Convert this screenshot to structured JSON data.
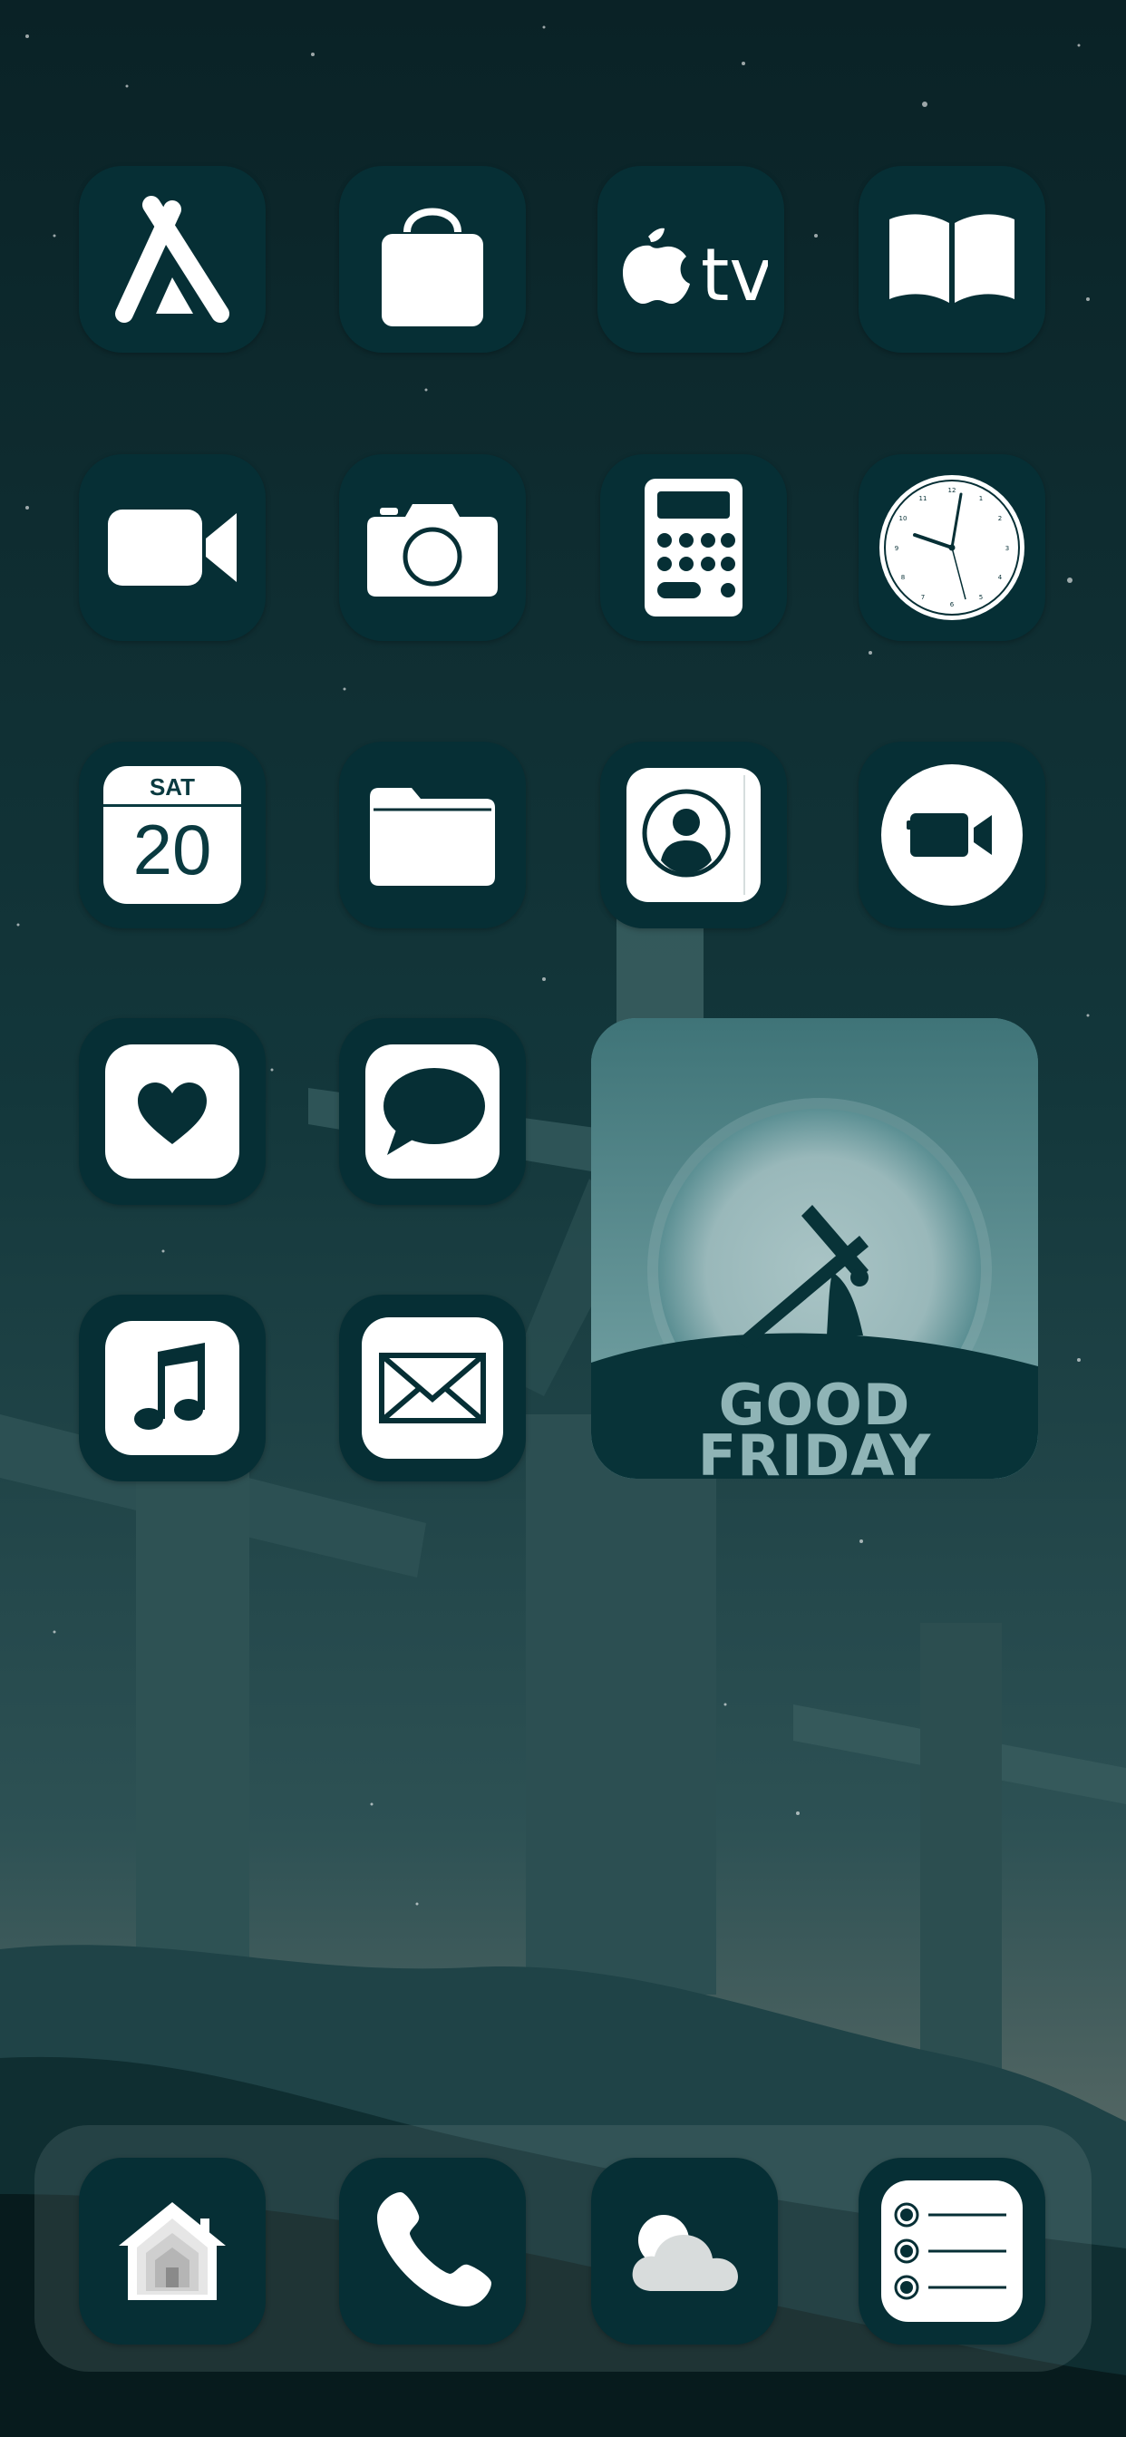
{
  "screen": "iPhone home screen",
  "colors": {
    "tile": "#062f35",
    "sky_top": "#0a2226",
    "sky_bottom": "#3a5c5e",
    "icon": "#ffffff",
    "widget_text": "#8fb4b6"
  },
  "apps": [
    {
      "name": "App Store",
      "icon": "app-store-icon"
    },
    {
      "name": "Shopping",
      "icon": "shopping-bag-icon"
    },
    {
      "name": "Apple TV",
      "icon": "apple-tv-icon"
    },
    {
      "name": "Books",
      "icon": "book-icon"
    },
    {
      "name": "FaceTime",
      "icon": "video-camera-icon"
    },
    {
      "name": "Camera",
      "icon": "camera-icon"
    },
    {
      "name": "Calculator",
      "icon": "calculator-icon"
    },
    {
      "name": "Clock",
      "icon": "clock-icon"
    },
    {
      "name": "Calendar",
      "icon": "calendar-icon"
    },
    {
      "name": "Files",
      "icon": "folder-icon"
    },
    {
      "name": "Contacts",
      "icon": "contacts-icon"
    },
    {
      "name": "Clips",
      "icon": "video-circle-icon"
    },
    {
      "name": "Health",
      "icon": "heart-icon"
    },
    {
      "name": "Messages",
      "icon": "chat-bubble-icon"
    },
    {
      "name": "Music",
      "icon": "music-note-icon"
    },
    {
      "name": "Mail",
      "icon": "mail-icon"
    }
  ],
  "calendar": {
    "day": "SAT",
    "date": "20"
  },
  "tv_label": "tv",
  "widget": {
    "line1": "GOOD",
    "line2": "FRIDAY"
  },
  "dock": [
    {
      "name": "Home",
      "icon": "home-icon"
    },
    {
      "name": "Phone",
      "icon": "phone-icon"
    },
    {
      "name": "Weather",
      "icon": "weather-icon"
    },
    {
      "name": "Reminders",
      "icon": "reminders-icon"
    }
  ]
}
